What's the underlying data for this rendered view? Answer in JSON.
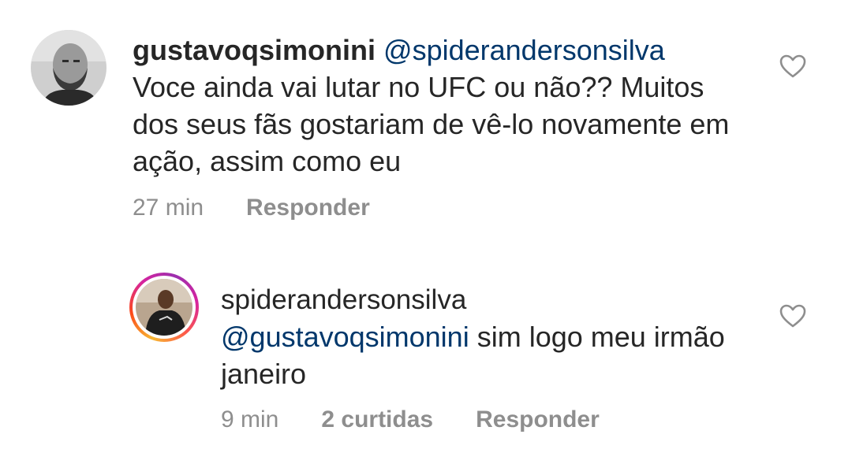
{
  "comments": [
    {
      "username": "gustavoqsimonini",
      "mention": "@spiderandersonsilva",
      "text": "Voce ainda vai lutar no UFC ou não?? Muitos dos seus fãs gostariam de vê-lo novamente em ação, assim como eu",
      "time": "27 min",
      "reply_label": "Responder",
      "avatar_icon": "user-photo-icon",
      "like_icon": "heart-outline-icon"
    },
    {
      "username": "spiderandersonsilva",
      "mention": "@gustavoqsimonini",
      "text": "sim logo meu irmão  janeiro",
      "time": "9 min",
      "likes": "2 curtidas",
      "reply_label": "Responder",
      "avatar_icon": "user-photo-icon",
      "like_icon": "heart-outline-icon",
      "story_ring_colors": [
        "#f7b733",
        "#fc4a1a",
        "#d6249f"
      ]
    }
  ],
  "colors": {
    "text": "#262626",
    "mention": "#00376b",
    "meta": "#8e8e8e"
  }
}
